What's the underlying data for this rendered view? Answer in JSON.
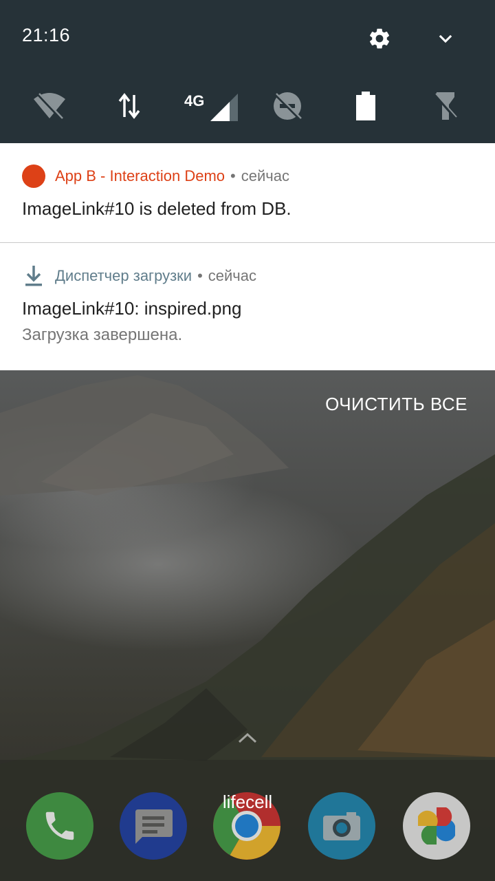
{
  "status": {
    "time": "21:16"
  },
  "header": {
    "settings_icon": "gear-icon",
    "expand_icon": "chevron-down-icon"
  },
  "quick_tiles": [
    {
      "name": "wifi-off-icon",
      "label": ""
    },
    {
      "name": "data-transfer-icon",
      "label": ""
    },
    {
      "name": "cellular-signal-icon",
      "label": "4G"
    },
    {
      "name": "dnd-off-icon",
      "label": ""
    },
    {
      "name": "battery-icon",
      "label": ""
    },
    {
      "name": "flashlight-off-icon",
      "label": ""
    }
  ],
  "notifications": [
    {
      "app_name": "App B - Interaction Demo",
      "separator": "•",
      "time": "сейчас",
      "title": "ImageLink#10 is deleted from DB.",
      "text": "",
      "accent": "#dd4117",
      "icon": "red-circle-icon"
    },
    {
      "app_name": "Диспетчер загрузки",
      "separator": "•",
      "time": "сейчас",
      "title": "ImageLink#10: inspired.png",
      "text": "Загрузка завершена.",
      "accent": "#607d8b",
      "icon": "download-icon"
    }
  ],
  "clear_all": "ОЧИСТИТЬ ВСЕ",
  "carrier": "lifecell",
  "dock": [
    {
      "name": "phone-app-icon",
      "color": "#43a047"
    },
    {
      "name": "messages-app-icon",
      "color": "#1e3fa8"
    },
    {
      "name": "chrome-app-icon",
      "color": "#d32f2f"
    },
    {
      "name": "camera-app-icon",
      "color": "#1e88b5"
    },
    {
      "name": "photos-app-icon",
      "color": "#eeeeee"
    }
  ]
}
